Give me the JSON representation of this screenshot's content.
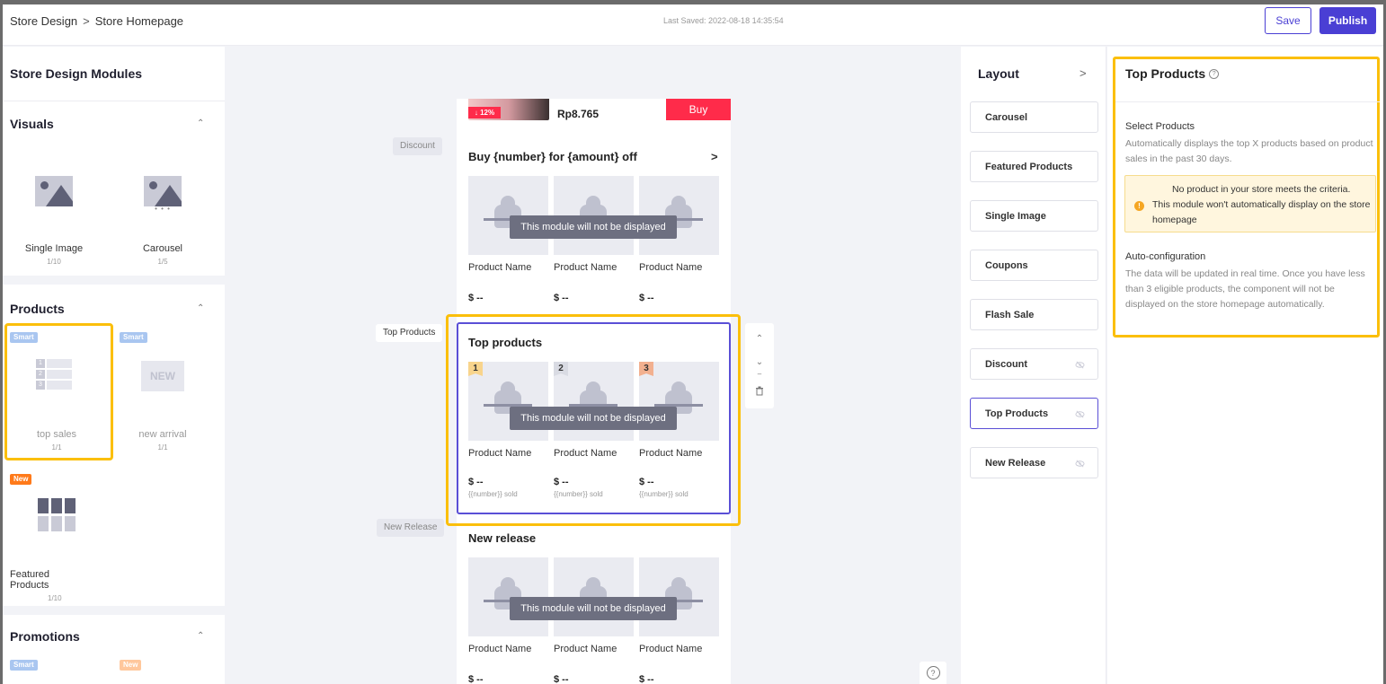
{
  "header": {
    "breadcrumb": [
      "Store Design",
      "Store Homepage"
    ],
    "breadcrumb_sep": ">",
    "last_saved": "Last Saved: 2022-08-18 14:35:54",
    "save_label": "Save",
    "publish_label": "Publish"
  },
  "left_panel": {
    "title": "Store Design Modules",
    "visuals": {
      "title": "Visuals",
      "modules": [
        {
          "name": "Single Image",
          "count": "1/10"
        },
        {
          "name": "Carousel",
          "count": "1/5"
        }
      ]
    },
    "products": {
      "title": "Products",
      "modules": [
        {
          "name": "top sales",
          "count": "1/1",
          "tag": "Smart"
        },
        {
          "name": "new arrival",
          "count": "1/1",
          "tag": "Smart",
          "box_text": "NEW"
        },
        {
          "name": "Featured Products",
          "count": "1/10",
          "tag": "New"
        }
      ],
      "rank_digits": [
        "1",
        "2",
        "3"
      ]
    },
    "promotions": {
      "title": "Promotions",
      "tags": [
        "Smart",
        "New"
      ]
    }
  },
  "canvas": {
    "flash": {
      "discount": "↓ 12%",
      "price": "Rp8.765",
      "buy": "Buy"
    },
    "labels": {
      "discount": "Discount",
      "top_products": "Top Products",
      "new_release": "New Release"
    },
    "discount_section": {
      "title": "Buy {number} for {amount} off",
      "arrow": ">",
      "products": [
        {
          "name": "Product Name",
          "price": "$ --"
        },
        {
          "name": "Product Name",
          "price": "$ --"
        },
        {
          "name": "Product Name",
          "price": "$ --"
        }
      ]
    },
    "top_products_section": {
      "title": "Top products",
      "products": [
        {
          "rank": "1",
          "name": "Product Name",
          "price": "$ --",
          "sold": "{{number}} sold"
        },
        {
          "rank": "2",
          "name": "Product Name",
          "price": "$ --",
          "sold": "{{number}} sold"
        },
        {
          "rank": "3",
          "name": "Product Name",
          "price": "$ --",
          "sold": "{{number}} sold"
        }
      ]
    },
    "new_release_section": {
      "title": "New release",
      "products": [
        {
          "name": "Product Name",
          "price": "$ --"
        },
        {
          "name": "Product Name",
          "price": "$ --"
        },
        {
          "name": "Product Name",
          "price": "$ --"
        }
      ]
    },
    "overlay_message": "This module will not be displayed",
    "tools": [
      "^",
      "v",
      "--",
      "delete"
    ],
    "help": "?"
  },
  "layout_panel": {
    "title": "Layout",
    "chevron": ">",
    "items": [
      {
        "label": "Carousel",
        "hidden": false
      },
      {
        "label": "Featured Products",
        "hidden": false
      },
      {
        "label": "Single Image",
        "hidden": false
      },
      {
        "label": "Coupons",
        "hidden": false
      },
      {
        "label": "Flash Sale",
        "hidden": false
      },
      {
        "label": "Discount",
        "hidden": true
      },
      {
        "label": "Top Products",
        "hidden": true,
        "active": true
      },
      {
        "label": "New Release",
        "hidden": true
      }
    ]
  },
  "properties": {
    "title": "Top Products",
    "select_products_label": "Select Products",
    "select_products_desc": "Automatically displays the top X products based on product sales in the past 30 days.",
    "warning_line1": "No product in your store meets the criteria.",
    "warning_line2": "This module won't automatically display on the store homepage",
    "auto_config_label": "Auto-configuration",
    "auto_config_desc": "The data will be updated in real time. Once you have less than 3 eligible products, the component will not be displayed on the store homepage automatically."
  },
  "colors": {
    "accent": "#4a3fd4",
    "highlight": "#fbbf0b",
    "sale_red": "#ff2b4a",
    "warning_bg": "#fff6de"
  }
}
